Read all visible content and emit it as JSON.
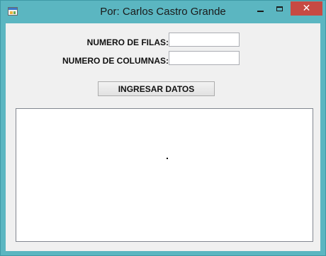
{
  "window": {
    "title": "Por: Carlos Castro Grande",
    "close_glyph": "✕"
  },
  "form": {
    "rows_label": "NUMERO DE FILAS:",
    "rows_value": "",
    "cols_label": "NUMERO DE COLUMNAS:",
    "cols_value": "",
    "submit_label": "INGRESAR DATOS"
  },
  "output": {
    "text": ""
  },
  "icons": {
    "app": "app-window-icon",
    "minimize": "minimize-icon",
    "maximize": "maximize-icon",
    "close": "close-icon"
  },
  "colors": {
    "frame": "#5bb6c1",
    "client": "#f0f0f0",
    "close_button": "#c74a43"
  }
}
